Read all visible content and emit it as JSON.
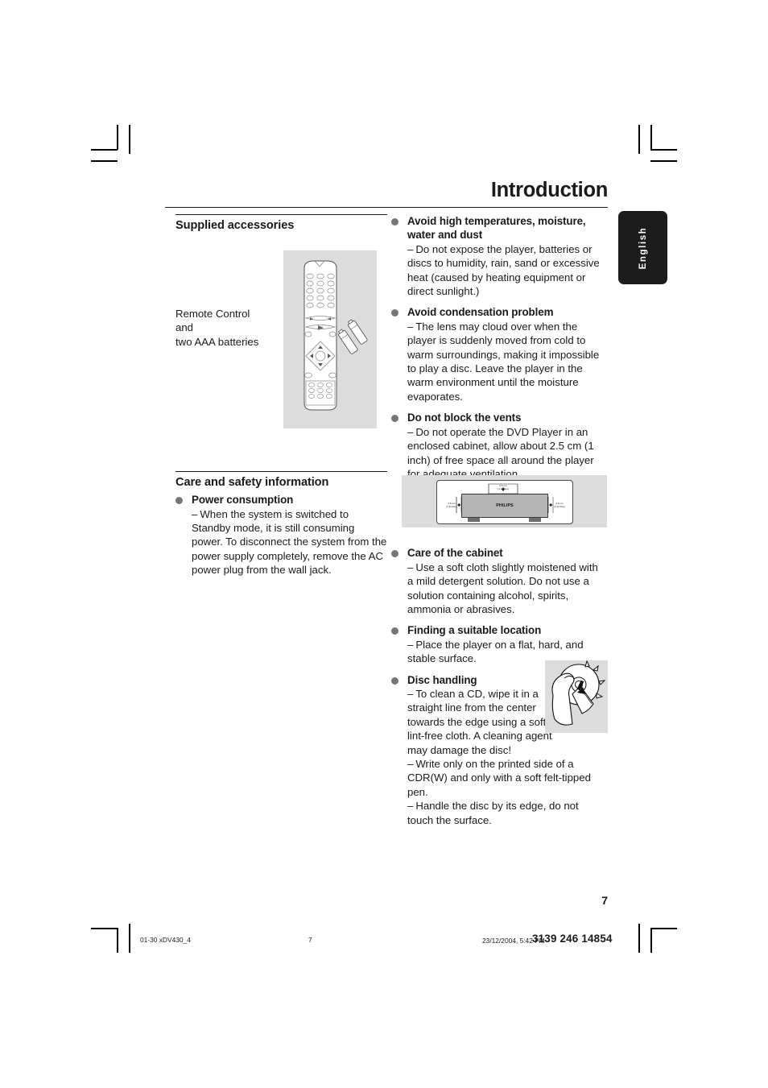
{
  "header": {
    "title": "Introduction"
  },
  "side_tab": {
    "label": "English"
  },
  "left_column": {
    "section_title": "Supplied accessories",
    "remote_caption": "Remote Control\nand\ntwo AAA batteries",
    "care_section_title": "Care and safety information",
    "entries": [
      {
        "title": "Power consumption",
        "dash": "–",
        "body": "When the system is switched to Standby mode, it is still consuming power. To disconnect the system from the power supply completely, remove the AC power plug from the wall jack."
      }
    ]
  },
  "right_column": {
    "entries": [
      {
        "title": "Avoid high temperatures, moisture, water and dust",
        "dash": "–",
        "body": "Do not expose the player, batteries or discs to humidity, rain, sand or excessive heat (caused by heating equipment or direct sunlight.)"
      },
      {
        "title": "Avoid condensation problem",
        "dash": "–",
        "body": "The lens may cloud over when the player is suddenly moved from cold to warm surroundings, making it impossible to play a disc. Leave the player in the warm environment until the moisture evaporates."
      },
      {
        "title": "Do not block the vents",
        "dash": "–",
        "body": "Do not operate the DVD Player in an enclosed cabinet,  allow about 2.5 cm (1 inch) of free space all around the player for adequate ventilation."
      },
      {
        "title": "Care of the cabinet",
        "dash": "–",
        "body": "Use a soft cloth slightly moistened with a mild detergent solution. Do not use a solution containing alcohol, spirits, ammonia or abrasives."
      },
      {
        "title": "Finding a suitable location",
        "dash": "–",
        "body": "Place the player on a flat, hard, and stable surface."
      },
      {
        "title": "Disc handling",
        "dash": "–",
        "body": "To clean a CD, wipe it in a straight line from the center towards the edge using a soft, lint-free cloth.  A cleaning agent may damage the disc!",
        "body2_dash": "–",
        "body2": "Write only on the printed side of a CDR(W) and only with a soft felt-tipped pen.",
        "body3_dash": "–",
        "body3": "Handle the disc by its edge, do not touch the surface."
      }
    ]
  },
  "vents_diagram": {
    "brand": "PHILIPS",
    "top_label": "2.5 cm\n(1 inches)",
    "left_label": "2.5 cm\n(1 inches)",
    "right_label": "2.5 cm\n(1 inches)"
  },
  "page_number": "7",
  "footer": {
    "file": "01-30 xDV430_4",
    "page": "7",
    "date": "23/12/2004, 5:42 PM",
    "code": "3139 246 14854"
  }
}
